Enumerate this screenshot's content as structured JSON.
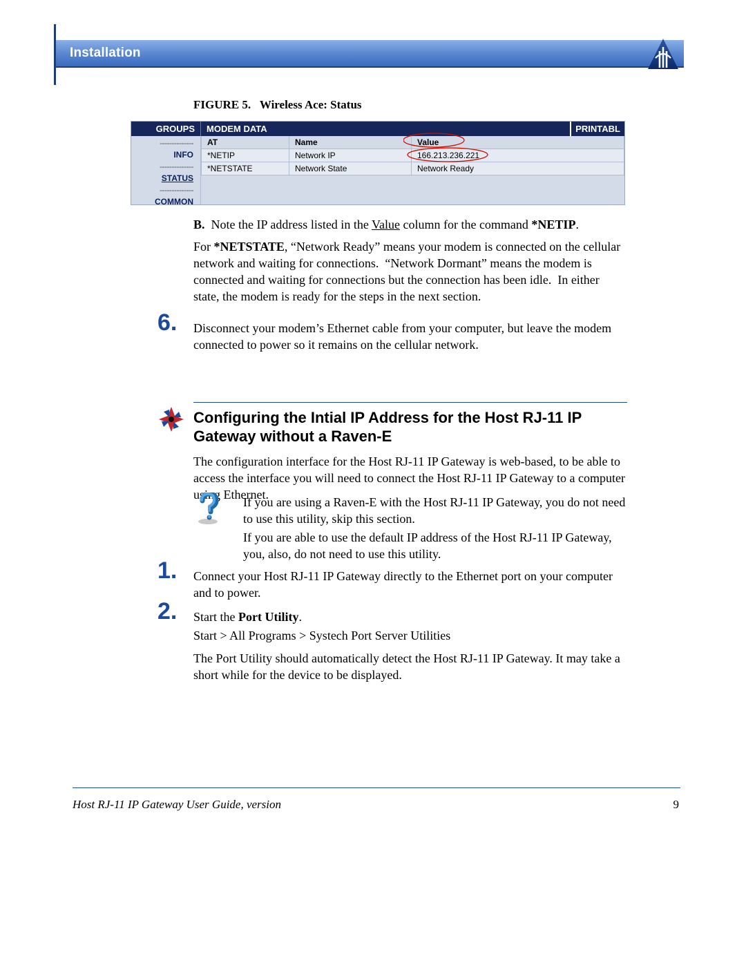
{
  "header": {
    "chapter": "Installation"
  },
  "figure": {
    "label": "FIGURE 5.",
    "title": "Wireless Ace: Status",
    "tabs": {
      "groups": "GROUPS",
      "modem_data": "MODEM DATA",
      "printable": "PRINTABL"
    },
    "sidebar": {
      "dash": "--------------",
      "info": "INFO",
      "status": "STATUS",
      "common": "COMMON"
    },
    "columns": {
      "at": "AT",
      "name": "Name",
      "value": "Value"
    },
    "rows": [
      {
        "at": "*NETIP",
        "name": "Network IP",
        "value": "166.213.236.221"
      },
      {
        "at": "*NETSTATE",
        "name": "Network State",
        "value": "Network Ready"
      }
    ]
  },
  "noteB": {
    "letter": "B.",
    "text1": "Note the IP address listed in the ",
    "underline": "Value",
    "text2": " column for the command ",
    "bold": "*NETIP",
    "period": "."
  },
  "netPara": "For *NETSTATE, “Network Ready” means your modem is connected on the cellular network and waiting for connections.  “Network Dormant” means the modem is connected and waiting for connections but the connection has been idle.  In either state, the modem is ready for the steps in the next section.",
  "step6": {
    "num": "6.",
    "text": "Disconnect your modem’s Ethernet cable from your computer, but leave the modem connected to power so it remains on the cellular network."
  },
  "section": {
    "title": "Configuring the Intial IP Address for the Host RJ-11 IP Gateway without a Raven-E"
  },
  "cfgIntro": "The configuration interface for the Host RJ-11 IP Gateway is web-based, to be able to access the interface you will need to connect the Host RJ-11 IP Gateway to a computer using Ethernet.",
  "tip1": "If you are using a Raven-E with the Host RJ-11 IP Gateway, you do not need to use this utility, skip this section.",
  "tip2": "If you are able to use the default IP address of the Host RJ-11 IP Gateway, you, also, do not need to use this utility.",
  "step1": {
    "num": "1.",
    "text": "Connect your Host RJ-11 IP Gateway directly to the Ethernet port on your computer and to power."
  },
  "step2": {
    "num": "2.",
    "l1a": "Start the ",
    "l1b": "Port Utility",
    "l1c": ".",
    "l2": "Start > All Programs > Systech Port Server Utilities",
    "l3": "The Port Utility should automatically detect the Host RJ-11 IP Gateway. It may take a short while for the device to be displayed."
  },
  "footer": {
    "title": "Host RJ-11 IP Gateway User Guide, version",
    "page": "9"
  }
}
